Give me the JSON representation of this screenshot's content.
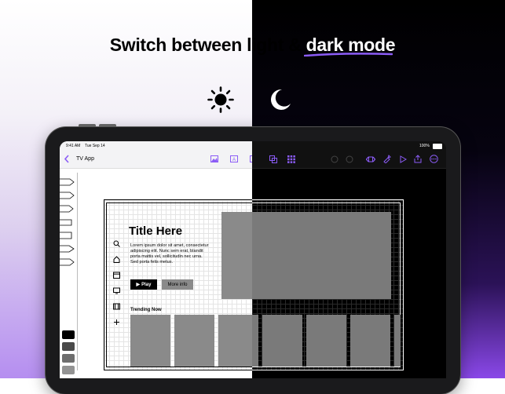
{
  "headline": {
    "part_light": "Switch between light & ",
    "part_dark": "dark mode"
  },
  "icons": {
    "sun": "sun-icon",
    "moon": "moon-icon"
  },
  "colors": {
    "accent": "#8b5cf6",
    "light_bg": "#ffffff",
    "dark_bg": "#000000"
  },
  "status_bar": {
    "time": "9:41 AM",
    "date": "Tue Sep 14",
    "battery": "100%"
  },
  "toolbar": {
    "back_icon": "chevron-left-icon",
    "doc_title": "TV App"
  },
  "palette": {
    "tools": [
      "pencil-icon",
      "pen-icon",
      "marker-icon",
      "ruler-icon",
      "eraser-icon",
      "crayon-icon",
      "brush-icon"
    ],
    "swatch_colors": [
      "#000000",
      "#4a4a4a",
      "#6e6e6e",
      "#939393",
      "#c8c8c8"
    ],
    "swatch_active_color": "#8b5cf6"
  },
  "artboard": {
    "title": "Title Here",
    "body": "Lorem ipsum dolor sit amet, consectetur adipiscing elit. Nunc sem erat, blandit porta mattis vel, sollicitudin nec urna. Sed porta felis metus.",
    "play_label": "Play",
    "more_label": "More info",
    "trending_label": "Trending Now",
    "side_icons": [
      "search-icon",
      "home-icon",
      "calendar-icon",
      "tv-icon",
      "film-icon",
      "plus-icon"
    ]
  }
}
